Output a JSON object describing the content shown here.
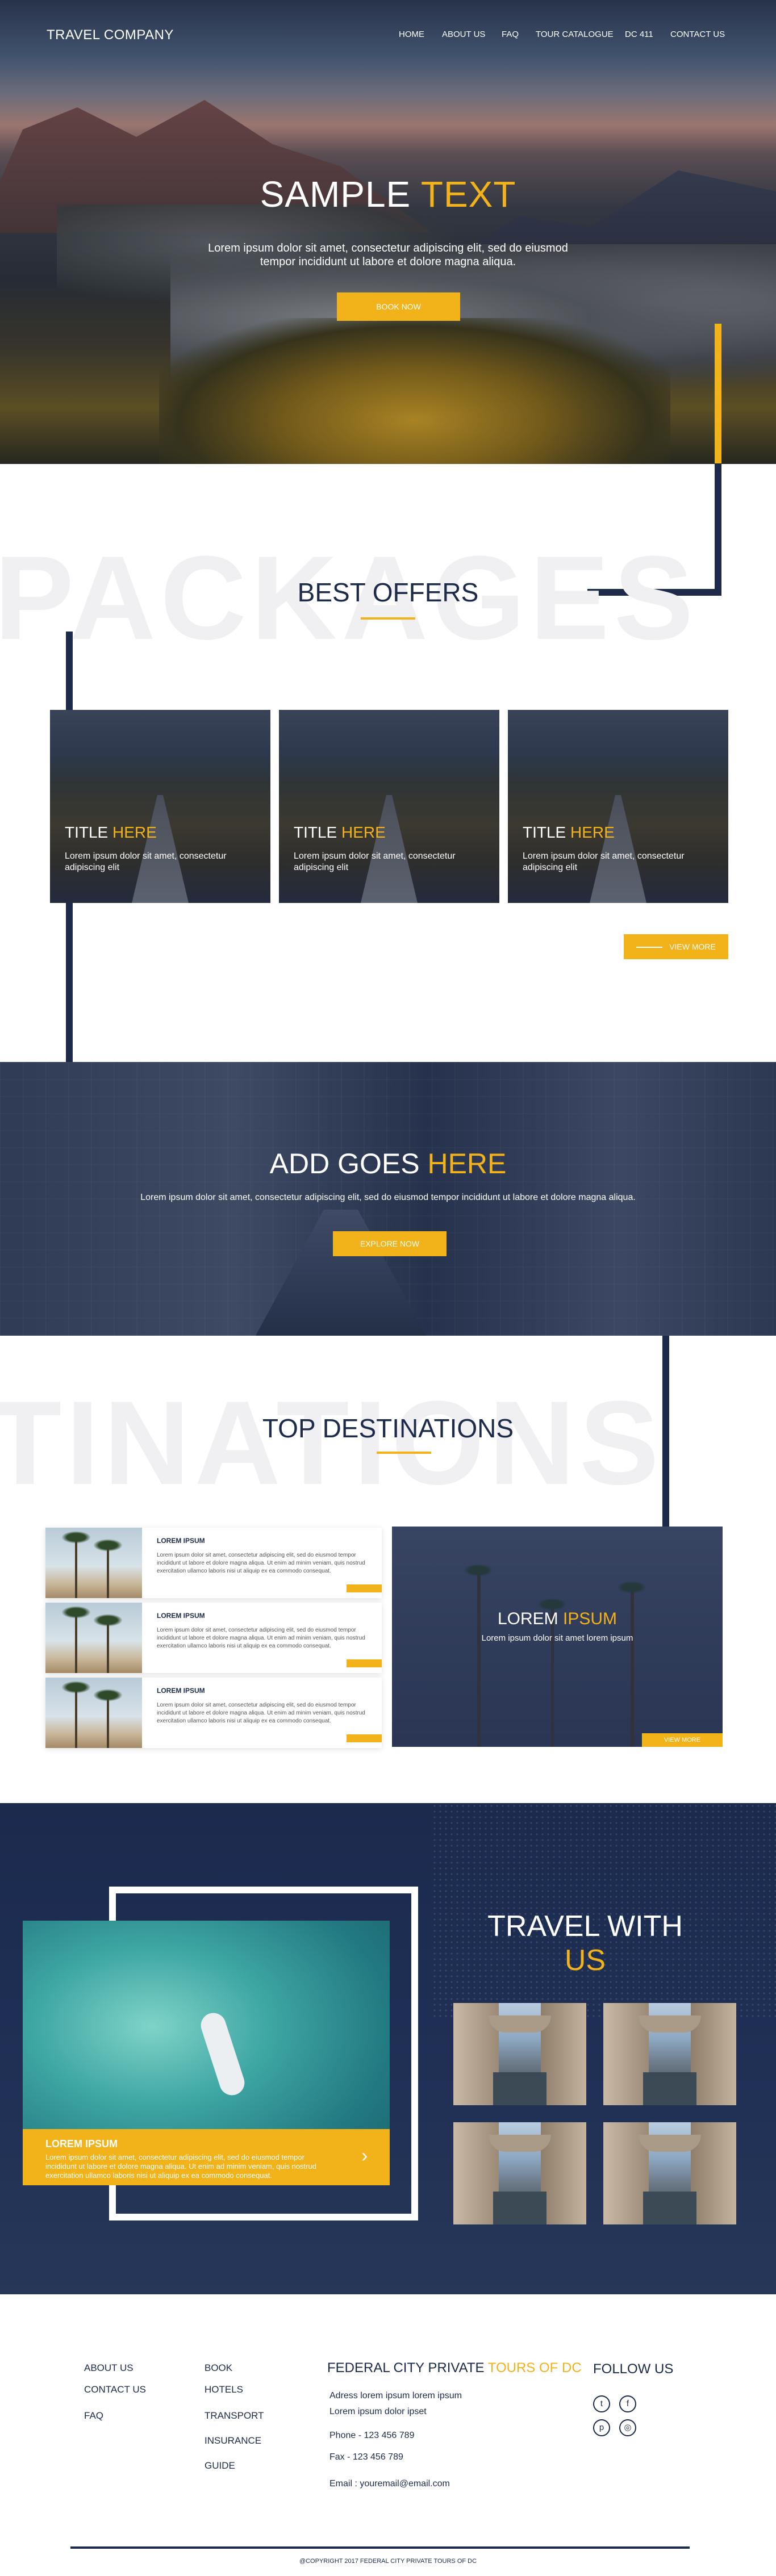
{
  "header": {
    "brand": "TRAVEL COMPANY",
    "nav": [
      "HOME",
      "ABOUT US",
      "FAQ",
      "TOUR CATALOGUE",
      "DC 411",
      "CONTACT US"
    ]
  },
  "hero": {
    "title_a": "SAMPLE",
    "title_b": "TEXT",
    "subtitle": "Lorem ipsum dolor sit amet, consectetur adipiscing elit, sed do eiusmod tempor incididunt ut labore et dolore magna aliqua.",
    "button": "BOOK NOW"
  },
  "packages": {
    "ghost": "PACKAGES",
    "title": "BEST OFFERS",
    "cards": [
      {
        "title_a": "TITLE",
        "title_b": "HERE",
        "desc": "Lorem ipsum dolor sit amet,  consectetur adipiscing elit"
      },
      {
        "title_a": "TITLE",
        "title_b": "HERE",
        "desc": "Lorem ipsum dolor sit amet,  consectetur adipiscing elit"
      },
      {
        "title_a": "TITLE",
        "title_b": "HERE",
        "desc": "Lorem ipsum dolor sit amet,  consectetur adipiscing elit"
      }
    ],
    "view_more": "VIEW MORE"
  },
  "banner": {
    "title_a": "ADD GOES",
    "title_b": "HERE",
    "subtitle": "Lorem ipsum dolor sit amet, consectetur adipiscing elit, sed do eiusmod tempor incididunt ut labore et dolore magna aliqua.",
    "button": "EXPLORE NOW"
  },
  "destinations": {
    "ghost": "TINATIONS",
    "title": "TOP DESTINATIONS",
    "items": [
      {
        "title": "LOREM IPSUM",
        "desc": "Lorem ipsum dolor sit amet, consectetur adipiscing elit, sed do eiusmod tempor incididunt ut labore et dolore magna aliqua. Ut enim ad minim veniam, quis nostrud exercitation ullamco laboris nisi ut aliquip ex ea commodo consequat."
      },
      {
        "title": "LOREM IPSUM",
        "desc": "Lorem ipsum dolor sit amet, consectetur adipiscing elit, sed do eiusmod tempor incididunt ut labore et dolore magna aliqua. Ut enim ad minim veniam, quis nostrud exercitation ullamco laboris nisi ut aliquip ex ea commodo consequat."
      },
      {
        "title": "LOREM IPSUM",
        "desc": "Lorem ipsum dolor sit amet, consectetur adipiscing elit, sed do eiusmod tempor incididunt ut labore et dolore magna aliqua. Ut enim ad minim veniam, quis nostrud exercitation ullamco laboris nisi ut aliquip ex ea commodo consequat."
      }
    ],
    "feature": {
      "title_a": "LOREM",
      "title_b": "IPSUM",
      "desc": "Lorem ipsum dolor sit amet lorem ipsum",
      "button": "VIEW MORE"
    }
  },
  "travel": {
    "title_a": "TRAVEL WITH",
    "title_b": "US",
    "promo_title": "LOREM IPSUM",
    "promo_desc": "Lorem ipsum dolor sit amet, consectetur adipiscing elit, sed do eiusmod tempor incididunt ut labore et dolore magna aliqua. Ut enim ad minim veniam, quis nostrud exercitation ullamco laboris nisi ut aliquip ex ea commodo consequat.",
    "arrow": "›"
  },
  "footer": {
    "col1": [
      "ABOUT US",
      "CONTACT US",
      "FAQ"
    ],
    "col2": [
      "BOOK",
      "HOTELS",
      "TRANSPORT",
      "INSURANCE",
      "GUIDE"
    ],
    "company_a": "FEDERAL CITY PRIVATE",
    "company_b": "TOURS OF DC",
    "address1": "Adress lorem ipsum lorem ipsum",
    "address2": "Lorem ipsum dolor ipset",
    "phone": "Phone - 123 456 789",
    "fax": "Fax - 123 456 789",
    "email": "Email : youremail@email.com",
    "follow": "FOLLOW US",
    "social": [
      "twitter-icon",
      "facebook-icon",
      "pinterest-icon",
      "instagram-icon"
    ],
    "copyright": "@COPYRIGHT 2017 FEDERAL CITY PRIVATE TOURS OF DC"
  },
  "colors": {
    "accent": "#f2b219",
    "navy": "#1d2a4a"
  }
}
